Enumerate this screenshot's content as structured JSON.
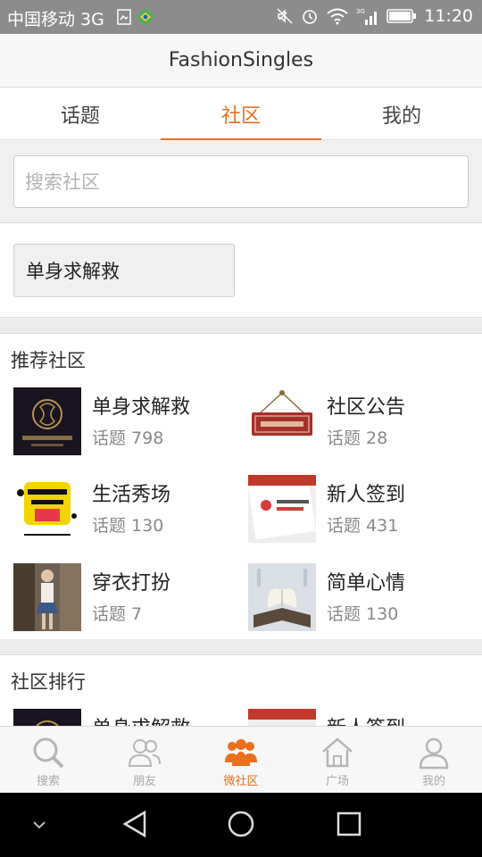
{
  "status_bar": {
    "carrier": "中国移动 3G",
    "time": "11:20",
    "icons": [
      "sim-card-icon",
      "app-badge-icon",
      "mute-icon",
      "alarm-icon",
      "wifi-icon",
      "signal-icon",
      "battery-icon"
    ]
  },
  "app": {
    "title": "FashionSingles"
  },
  "tabs": [
    {
      "label": "话题",
      "active": false
    },
    {
      "label": "社区",
      "active": true
    },
    {
      "label": "我的",
      "active": false
    }
  ],
  "search": {
    "placeholder": "搜索社区",
    "value": ""
  },
  "my_communities": [
    {
      "label": "单身求解救"
    }
  ],
  "recommend": {
    "title": "推荐社区",
    "items": [
      {
        "name": "单身求解救",
        "count": "话题 798",
        "thumb": "fashion-singles-logo"
      },
      {
        "name": "社区公告",
        "count": "话题 28",
        "thumb": "announcement-sign"
      },
      {
        "name": "生活秀场",
        "count": "话题 130",
        "thumb": "show-graphic"
      },
      {
        "name": "新人签到",
        "count": "话题 431",
        "thumb": "signin-card"
      },
      {
        "name": "穿衣打扮",
        "count": "话题 7",
        "thumb": "fashion-photo"
      },
      {
        "name": "简单心情",
        "count": "话题 130",
        "thumb": "book-heart-photo"
      }
    ]
  },
  "ranking": {
    "title": "社区排行",
    "items": [
      {
        "name": "单身求解救",
        "thumb": "fashion-singles-logo"
      },
      {
        "name": "新人签到",
        "thumb": "signin-card"
      }
    ]
  },
  "bottom_nav": [
    {
      "label": "搜索",
      "icon": "search-icon",
      "active": false
    },
    {
      "label": "朋友",
      "icon": "friends-icon",
      "active": false
    },
    {
      "label": "微社区",
      "icon": "community-icon",
      "active": true
    },
    {
      "label": "广场",
      "icon": "home-icon",
      "active": false
    },
    {
      "label": "我的",
      "icon": "profile-icon",
      "active": false
    }
  ],
  "colors": {
    "accent": "#e8701e",
    "status_bar": "#8c8c8c",
    "system_bar": "#000000"
  }
}
